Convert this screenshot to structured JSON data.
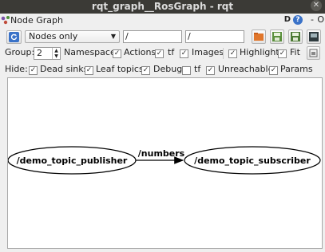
{
  "window": {
    "title": "rqt_graph__RosGraph - rqt"
  },
  "panel": {
    "title": "Node Graph",
    "d_label": "D",
    "help_label": "?",
    "minimize_label": "-",
    "close_label": "O"
  },
  "toolbar": {
    "mode_select": "Nodes only",
    "node_filter": "/",
    "topic_filter": "/"
  },
  "group_row": {
    "group_label": "Group:",
    "group_value": "2",
    "namespaces_label": "Namespaces",
    "actions_label": "Actions",
    "tf_label": "tf",
    "images_label": "Images",
    "highlight_label": "Highlight",
    "fit_label": "Fit"
  },
  "hide_row": {
    "hide_label": "Hide:",
    "dead_sinks_label": "Dead sinks",
    "leaf_topics_label": "Leaf topics",
    "debug_label": "Debug",
    "tf_label": "tf",
    "unreachable_label": "Unreachable",
    "params_label": "Params"
  },
  "checkboxes": {
    "namespaces": true,
    "actions": true,
    "tf": true,
    "images": true,
    "highlight": true,
    "fit": true,
    "dead_sinks": true,
    "leaf_topics": true,
    "debug": true,
    "hide_tf": false,
    "unreachable": true,
    "params": true
  },
  "graph": {
    "publisher": "/demo_topic_publisher",
    "topic": "/numbers",
    "subscriber": "/demo_topic_subscriber"
  },
  "colors": {
    "titlebar": "#3b3a36",
    "accent": "#3a72c8",
    "canvas": "#ffffff"
  }
}
